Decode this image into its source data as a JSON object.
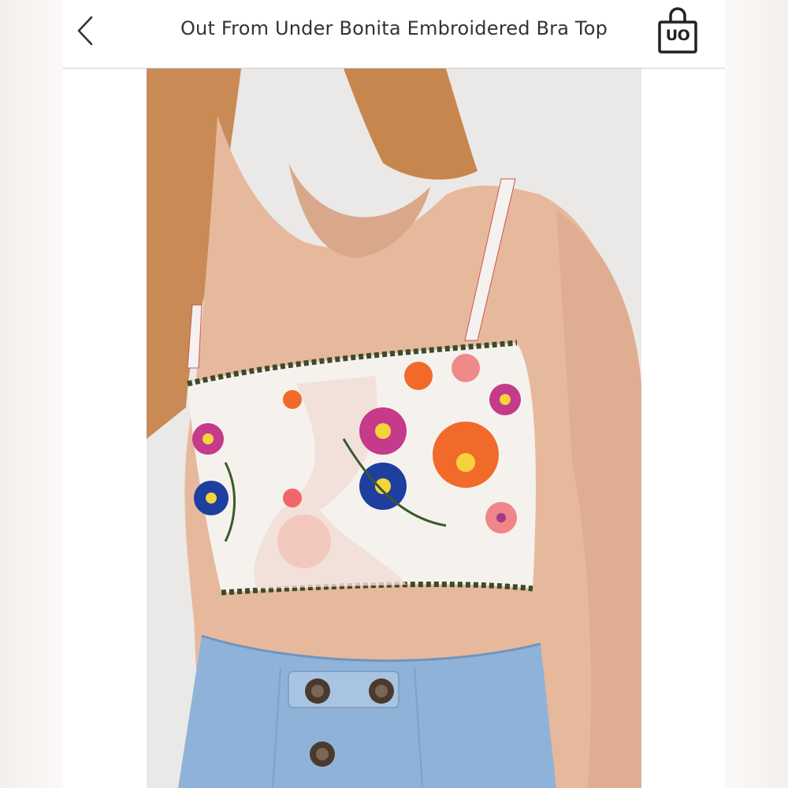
{
  "header": {
    "back_label": "Back",
    "title": "Out From Under Bonita Embroidered Bra Top",
    "brand_logo_text": "UO"
  },
  "icons": {
    "back": "chevron-left-icon",
    "bag": "shopping-bag-icon"
  },
  "photo": {
    "subject": "product-photo"
  },
  "colors": {
    "background": "#ffffff",
    "divider": "#cfcfcf",
    "text": "#333333"
  }
}
